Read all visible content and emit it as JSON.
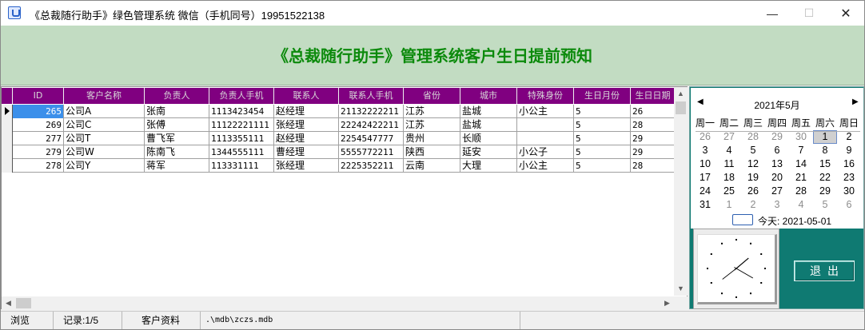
{
  "window": {
    "title": "《总裁随行助手》绿色管理系统  微信（手机同号）19951522138",
    "min_glyph": "—",
    "max_glyph": "☐",
    "close_glyph": "✕"
  },
  "header": {
    "title": "《总裁随行助手》管理系统客户生日提前预知"
  },
  "grid": {
    "columns": [
      "ID",
      "客户名称",
      "负责人",
      "负责人手机",
      "联系人",
      "联系人手机",
      "省份",
      "城市",
      "特殊身份",
      "生日月份",
      "生日日期"
    ],
    "rows": [
      [
        "265",
        "公司A",
        "张南",
        "1113423454",
        "赵经理",
        "21132222211",
        "江苏",
        "盐城",
        "小公主",
        "5",
        "26"
      ],
      [
        "269",
        "公司C",
        "张傅",
        "11122221111",
        "张经理",
        "22242422211",
        "江苏",
        "盐城",
        "",
        "5",
        "28"
      ],
      [
        "277",
        "公司T",
        "曹飞军",
        "1113355111",
        "赵经理",
        "2254547777",
        "贵州",
        "长顺",
        "",
        "5",
        "29"
      ],
      [
        "279",
        "公司W",
        "陈南飞",
        "1344555111",
        "曹经理",
        "5555772211",
        "陕西",
        "延安",
        "小公子",
        "5",
        "29"
      ],
      [
        "278",
        "公司Y",
        "蒋军",
        "113331111",
        "张经理",
        "2225352211",
        "云南",
        "大理",
        "小公主",
        "5",
        "28"
      ]
    ],
    "colors": {
      "header_bg": "#800080",
      "header_text": "#d8d8d8",
      "selection": "#3b8fea"
    }
  },
  "calendar": {
    "month_label": "2021年5月",
    "prev_glyph": "◀",
    "next_glyph": "▶",
    "weekdays": [
      "周一",
      "周二",
      "周三",
      "周四",
      "周五",
      "周六",
      "周日"
    ],
    "weeks": [
      [
        "26",
        "27",
        "28",
        "29",
        "30",
        "1",
        "2"
      ],
      [
        "3",
        "4",
        "5",
        "6",
        "7",
        "8",
        "9"
      ],
      [
        "10",
        "11",
        "12",
        "13",
        "14",
        "15",
        "16"
      ],
      [
        "17",
        "18",
        "19",
        "20",
        "21",
        "22",
        "23"
      ],
      [
        "24",
        "25",
        "26",
        "27",
        "28",
        "29",
        "30"
      ],
      [
        "31",
        "1",
        "2",
        "3",
        "4",
        "5",
        "6"
      ]
    ],
    "today_label": "今天: 2021-05-01"
  },
  "clock": {
    "hour_hand_angle_deg": 50,
    "minute_hand_angle_deg": 120,
    "second_hand_angle_deg": 232
  },
  "side": {
    "exit_label": "退出"
  },
  "status": {
    "mode": "浏览",
    "record": "记录:1/5",
    "section": "客户资料",
    "db_path": ".\\mdb\\zczs.mdb"
  },
  "colors": {
    "header_band": "#c2dcc2",
    "header_text": "#0c8a0c",
    "side_panel": "#0f7a72"
  }
}
